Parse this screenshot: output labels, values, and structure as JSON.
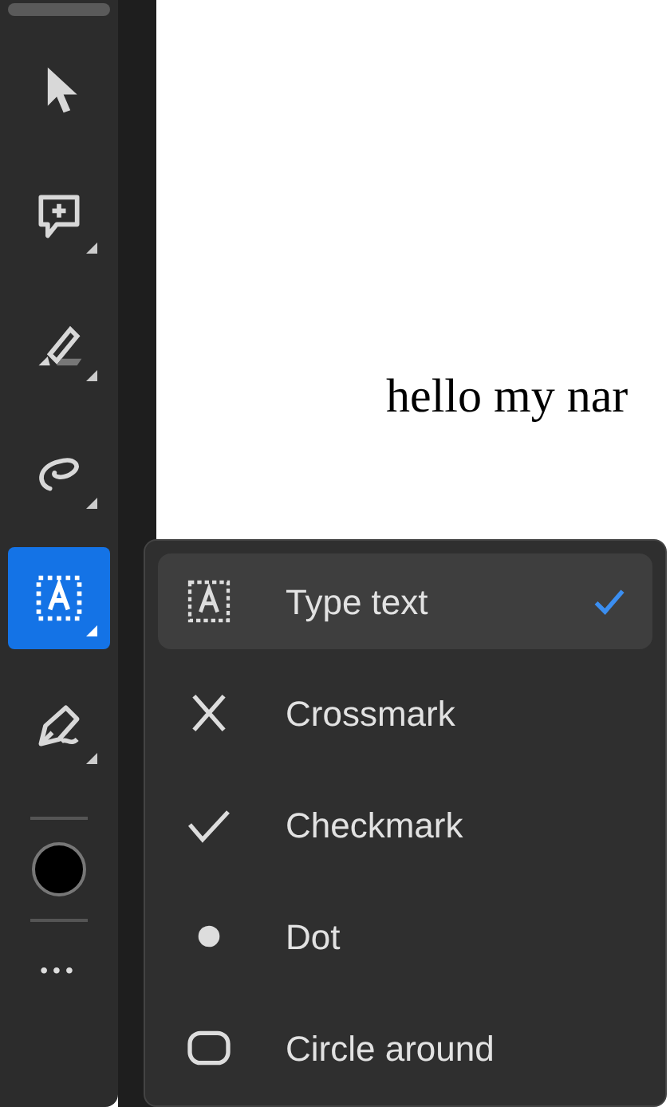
{
  "toolbar": {
    "tools": [
      {
        "kind": "select",
        "selected": false,
        "submenu": false
      },
      {
        "kind": "comment",
        "selected": false,
        "submenu": true
      },
      {
        "kind": "highlight",
        "selected": false,
        "submenu": true
      },
      {
        "kind": "draw",
        "selected": false,
        "submenu": true
      },
      {
        "kind": "text",
        "selected": true,
        "submenu": true
      },
      {
        "kind": "sign",
        "selected": false,
        "submenu": true
      }
    ],
    "color_swatch": {
      "color": "#000000"
    },
    "more": "•••"
  },
  "document": {
    "text": "hello my nar"
  },
  "menu": {
    "items": [
      {
        "kind": "text",
        "label": "Type text",
        "selected": true
      },
      {
        "kind": "cross",
        "label": "Crossmark",
        "selected": false
      },
      {
        "kind": "check",
        "label": "Checkmark",
        "selected": false
      },
      {
        "kind": "dot",
        "label": "Dot",
        "selected": false
      },
      {
        "kind": "circle",
        "label": "Circle around",
        "selected": false
      }
    ]
  }
}
